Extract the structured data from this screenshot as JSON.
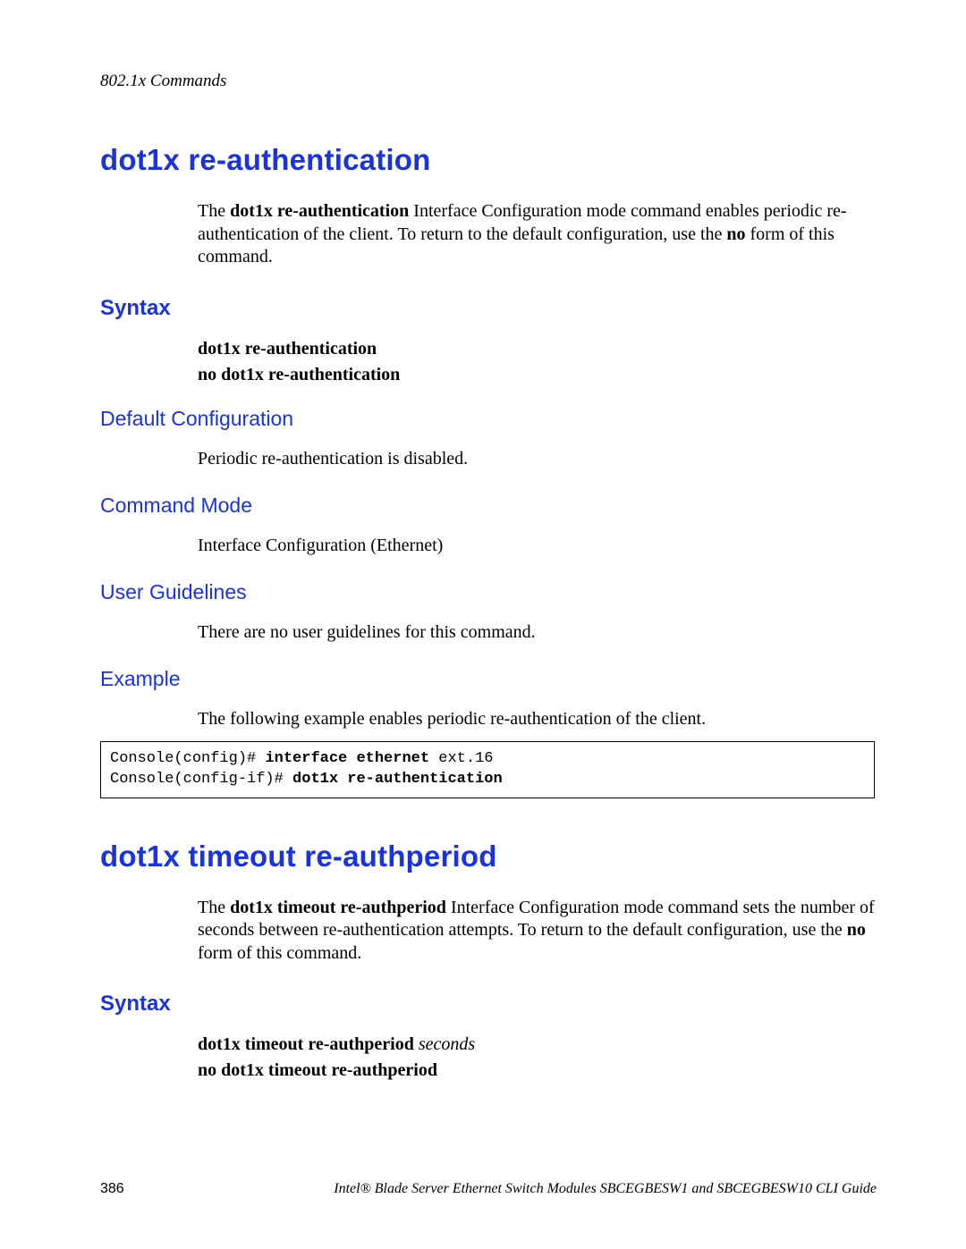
{
  "header": {
    "section": "802.1x Commands"
  },
  "cmd1": {
    "title": "dot1x re-authentication",
    "desc_pre": "The ",
    "desc_bold1": "dot1x re-authentication",
    "desc_mid": " Interface Configuration mode command enables periodic re-authentication of the client. To return to the default configuration, use the ",
    "desc_bold2": "no",
    "desc_post": " form of this command.",
    "syntax_heading": "Syntax",
    "syntax_line1": "dot1x re-authentication",
    "syntax_line2": "no dot1x re-authentication",
    "defconf_heading": "Default Configuration",
    "defconf_body": "Periodic re-authentication is disabled.",
    "mode_heading": "Command Mode",
    "mode_body": "Interface Configuration (Ethernet)",
    "ug_heading": "User Guidelines",
    "ug_body": "There are no user guidelines for this command.",
    "ex_heading": "Example",
    "ex_body": "The following example enables periodic re-authentication of the client.",
    "code": {
      "l1_pre": "Console(config)# ",
      "l1_bold": "interface ethernet",
      "l1_post": " ext.16",
      "l2_pre": "Console(config-if)# ",
      "l2_bold": "dot1x re-authentication"
    }
  },
  "cmd2": {
    "title": "dot1x timeout re-authperiod",
    "desc_pre": "The ",
    "desc_bold1": "dot1x timeout re-authperiod",
    "desc_mid": " Interface Configuration mode command sets the number of seconds between re-authentication attempts. To return to the default configuration, use the ",
    "desc_bold2": "no",
    "desc_post": " form of this command.",
    "syntax_heading": "Syntax",
    "syntax_line1_cmd": "dot1x timeout re-authperiod",
    "syntax_line1_arg": " seconds",
    "syntax_line2": "no dot1x timeout re-authperiod"
  },
  "footer": {
    "page": "386",
    "guide": "Intel® Blade Server Ethernet Switch Modules SBCEGBESW1 and SBCEGBESW10 CLI Guide"
  }
}
